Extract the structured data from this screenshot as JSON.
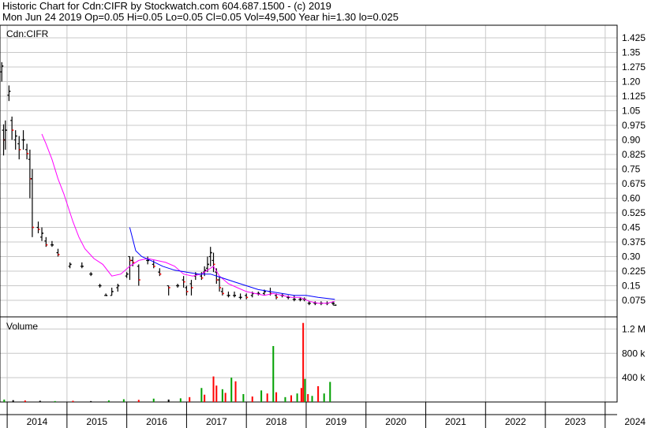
{
  "header": {
    "line1": "Historic Chart for Cdn:CIFR by Stockwatch.com 604.687.1500 - (c) 2019",
    "line2": "Mon Jun 24 2019  Op=0.05  Hi=0.05  Lo=0.05  Cl=0.05  Vol=49,500  Year hi=1.30  lo=0.025"
  },
  "colors": {
    "background": "#ffffff",
    "grid": "#c8c8c8",
    "axis": "#000000",
    "price_bar": "#000000",
    "price_down_tick": "#ff0000",
    "ma_short": "#ff00ff",
    "ma_long": "#0000ff",
    "volume_up": "#00a000",
    "volume_down": "#ff0000",
    "volume_flat": "#000000"
  },
  "chart_data": [
    {
      "type": "line",
      "panel": "price",
      "title": "Cdn:CIFR",
      "y_ticks": [
        "1.425",
        "1.35",
        "1.275",
        "1.20",
        "1.125",
        "1.05",
        "0.975",
        "0.90",
        "0.825",
        "0.75",
        "0.675",
        "0.60",
        "0.525",
        "0.45",
        "0.375",
        "0.30",
        "0.225",
        "0.15",
        "0.075"
      ],
      "ylim": [
        0.0,
        1.5
      ],
      "x_ticks": [
        "2014",
        "2015",
        "2016",
        "2017",
        "2018",
        "2019",
        "2020",
        "2021",
        "2022",
        "2023",
        "2024"
      ],
      "xlim": [
        2013.88,
        2024.2
      ],
      "grid": true,
      "series": [
        {
          "kind": "ohlc",
          "points": [
            [
              2013.91,
              1.25,
              1.3,
              1.2,
              1.28
            ],
            [
              2013.94,
              0.95,
              0.98,
              0.82,
              0.9
            ],
            [
              2013.97,
              0.9,
              1.0,
              0.85,
              0.95
            ],
            [
              2014.03,
              1.13,
              1.18,
              1.1,
              1.15
            ],
            [
              2014.08,
              1.0,
              1.02,
              0.9,
              0.95
            ],
            [
              2014.14,
              0.9,
              0.95,
              0.85,
              0.92
            ],
            [
              2014.2,
              0.88,
              0.92,
              0.8,
              0.85
            ],
            [
              2014.27,
              0.9,
              0.95,
              0.85,
              0.9
            ],
            [
              2014.33,
              0.85,
              0.88,
              0.8,
              0.83
            ],
            [
              2014.38,
              0.8,
              0.85,
              0.6,
              0.7
            ],
            [
              2014.42,
              0.7,
              0.75,
              0.4,
              0.45
            ],
            [
              2014.52,
              0.45,
              0.48,
              0.42,
              0.44
            ],
            [
              2014.58,
              0.4,
              0.45,
              0.38,
              0.42
            ],
            [
              2014.65,
              0.38,
              0.4,
              0.35,
              0.36
            ],
            [
              2014.75,
              0.36,
              0.38,
              0.35,
              0.36
            ],
            [
              2014.85,
              0.32,
              0.34,
              0.3,
              0.31
            ],
            [
              2015.05,
              0.25,
              0.27,
              0.24,
              0.26
            ],
            [
              2015.25,
              0.25,
              0.27,
              0.24,
              0.25
            ],
            [
              2015.4,
              0.21,
              0.22,
              0.2,
              0.21
            ],
            [
              2015.55,
              0.15,
              0.16,
              0.14,
              0.15
            ],
            [
              2015.65,
              0.1,
              0.11,
              0.1,
              0.1
            ],
            [
              2015.75,
              0.1,
              0.14,
              0.1,
              0.12
            ],
            [
              2015.85,
              0.14,
              0.16,
              0.12,
              0.15
            ],
            [
              2016.0,
              0.2,
              0.22,
              0.19,
              0.21
            ],
            [
              2016.05,
              0.3,
              0.3,
              0.18,
              0.28
            ],
            [
              2016.1,
              0.28,
              0.3,
              0.25,
              0.27
            ],
            [
              2016.2,
              0.25,
              0.26,
              0.15,
              0.18
            ],
            [
              2016.35,
              0.28,
              0.3,
              0.26,
              0.28
            ],
            [
              2016.45,
              0.26,
              0.28,
              0.24,
              0.25
            ],
            [
              2016.55,
              0.22,
              0.24,
              0.2,
              0.21
            ],
            [
              2016.7,
              0.15,
              0.15,
              0.1,
              0.14
            ],
            [
              2016.85,
              0.15,
              0.16,
              0.14,
              0.15
            ],
            [
              2016.95,
              0.18,
              0.2,
              0.14,
              0.17
            ],
            [
              2017.0,
              0.14,
              0.15,
              0.1,
              0.12
            ],
            [
              2017.08,
              0.16,
              0.18,
              0.1,
              0.14
            ],
            [
              2017.15,
              0.2,
              0.22,
              0.18,
              0.21
            ],
            [
              2017.25,
              0.2,
              0.22,
              0.18,
              0.19
            ],
            [
              2017.3,
              0.22,
              0.25,
              0.2,
              0.23
            ],
            [
              2017.35,
              0.24,
              0.3,
              0.22,
              0.26
            ],
            [
              2017.4,
              0.3,
              0.35,
              0.25,
              0.32
            ],
            [
              2017.45,
              0.28,
              0.32,
              0.22,
              0.26
            ],
            [
              2017.5,
              0.22,
              0.24,
              0.16,
              0.18
            ],
            [
              2017.55,
              0.18,
              0.2,
              0.12,
              0.14
            ],
            [
              2017.6,
              0.12,
              0.14,
              0.1,
              0.11
            ],
            [
              2017.7,
              0.1,
              0.12,
              0.09,
              0.1
            ],
            [
              2017.8,
              0.1,
              0.12,
              0.09,
              0.1
            ],
            [
              2017.9,
              0.09,
              0.11,
              0.08,
              0.09
            ],
            [
              2018.0,
              0.1,
              0.11,
              0.08,
              0.09
            ],
            [
              2018.1,
              0.1,
              0.12,
              0.09,
              0.11
            ],
            [
              2018.2,
              0.11,
              0.12,
              0.1,
              0.11
            ],
            [
              2018.3,
              0.11,
              0.13,
              0.1,
              0.12
            ],
            [
              2018.4,
              0.12,
              0.14,
              0.1,
              0.11
            ],
            [
              2018.5,
              0.1,
              0.11,
              0.08,
              0.09
            ],
            [
              2018.6,
              0.1,
              0.11,
              0.09,
              0.1
            ],
            [
              2018.7,
              0.09,
              0.1,
              0.08,
              0.09
            ],
            [
              2018.8,
              0.08,
              0.1,
              0.07,
              0.08
            ],
            [
              2018.9,
              0.08,
              0.09,
              0.07,
              0.08
            ],
            [
              2018.97,
              0.08,
              0.09,
              0.07,
              0.08
            ],
            [
              2019.05,
              0.06,
              0.07,
              0.05,
              0.06
            ],
            [
              2019.15,
              0.06,
              0.07,
              0.05,
              0.06
            ],
            [
              2019.25,
              0.06,
              0.07,
              0.05,
              0.06
            ],
            [
              2019.35,
              0.06,
              0.07,
              0.05,
              0.06
            ],
            [
              2019.45,
              0.06,
              0.07,
              0.05,
              0.06
            ],
            [
              2019.48,
              0.05,
              0.05,
              0.05,
              0.05
            ]
          ]
        },
        {
          "kind": "moving_average_short",
          "x": [
            2014.58,
            2014.65,
            2014.75,
            2014.85,
            2014.95,
            2015.1,
            2015.2,
            2015.3,
            2015.45,
            2015.6,
            2015.75,
            2015.9,
            2016.05,
            2016.2,
            2016.35,
            2016.5,
            2016.65,
            2016.8,
            2016.95,
            2017.1,
            2017.25,
            2017.35,
            2017.45,
            2017.55,
            2017.7,
            2017.85,
            2018.0,
            2018.15,
            2018.3,
            2018.45,
            2018.6,
            2018.75,
            2018.9,
            2019.05,
            2019.2,
            2019.35,
            2019.48
          ],
          "y": [
            0.93,
            0.88,
            0.8,
            0.7,
            0.62,
            0.48,
            0.4,
            0.34,
            0.29,
            0.26,
            0.2,
            0.21,
            0.25,
            0.28,
            0.29,
            0.28,
            0.27,
            0.25,
            0.21,
            0.2,
            0.21,
            0.23,
            0.25,
            0.2,
            0.16,
            0.14,
            0.12,
            0.11,
            0.1,
            0.11,
            0.1,
            0.09,
            0.09,
            0.07,
            0.06,
            0.06,
            0.07
          ]
        },
        {
          "kind": "moving_average_long",
          "x": [
            2016.05,
            2016.15,
            2016.25,
            2016.4,
            2016.6,
            2016.8,
            2017.0,
            2017.2,
            2017.4,
            2017.6,
            2017.8,
            2018.0,
            2018.2,
            2018.4,
            2018.6,
            2018.8,
            2019.0,
            2019.2,
            2019.48
          ],
          "y": [
            0.45,
            0.33,
            0.3,
            0.28,
            0.25,
            0.23,
            0.22,
            0.21,
            0.21,
            0.19,
            0.17,
            0.15,
            0.13,
            0.12,
            0.11,
            0.1,
            0.1,
            0.09,
            0.08
          ]
        }
      ]
    },
    {
      "type": "bar",
      "panel": "volume",
      "title": "Volume",
      "y_ticks": [
        "1.2 M",
        "800 k",
        "400 k"
      ],
      "ylim": [
        0,
        1400000
      ],
      "x_ticks": [
        "2014",
        "2015",
        "2016",
        "2017",
        "2018",
        "2019",
        "2020",
        "2021",
        "2022",
        "2023",
        "2024"
      ],
      "xlim": [
        2013.88,
        2024.2
      ],
      "grid": true,
      "x": [
        2013.95,
        2014.1,
        2014.3,
        2014.55,
        2014.8,
        2015.1,
        2015.4,
        2015.7,
        2015.95,
        2016.2,
        2016.45,
        2016.7,
        2016.9,
        2017.05,
        2017.25,
        2017.3,
        2017.45,
        2017.5,
        2017.6,
        2017.65,
        2017.75,
        2017.82,
        2017.95,
        2018.1,
        2018.25,
        2018.35,
        2018.45,
        2018.5,
        2018.65,
        2018.75,
        2018.85,
        2018.92,
        2018.95,
        2018.98,
        2019.03,
        2019.1,
        2019.2,
        2019.3,
        2019.4
      ],
      "values": [
        40000,
        30000,
        25000,
        20000,
        15000,
        20000,
        15000,
        25000,
        45000,
        35000,
        55000,
        40000,
        60000,
        80000,
        230000,
        120000,
        420000,
        270000,
        210000,
        150000,
        400000,
        340000,
        130000,
        90000,
        190000,
        140000,
        920000,
        160000,
        80000,
        110000,
        140000,
        230000,
        1300000,
        380000,
        130000,
        100000,
        260000,
        140000,
        330000
      ],
      "directions": [
        "up",
        "flat",
        "down",
        "flat",
        "up",
        "down",
        "flat",
        "up",
        "up",
        "down",
        "up",
        "flat",
        "up",
        "down",
        "up",
        "down",
        "down",
        "red",
        "up",
        "red",
        "up",
        "red",
        "up",
        "down",
        "up",
        "red",
        "up",
        "red",
        "up",
        "down",
        "up",
        "red",
        "down",
        "up",
        "red",
        "up",
        "red",
        "up",
        "up"
      ]
    }
  ]
}
